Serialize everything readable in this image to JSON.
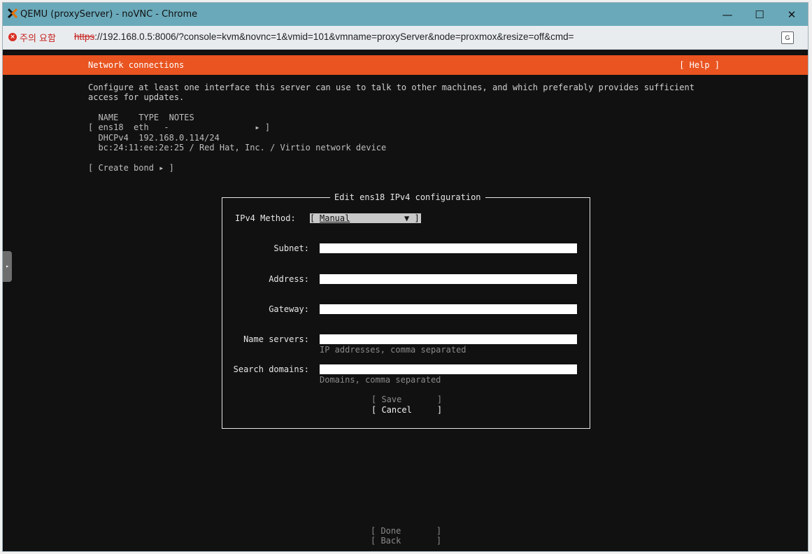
{
  "window": {
    "title": "QEMU (proxyServer) - noVNC - Chrome"
  },
  "controls": {
    "minimize": "—",
    "maximize": "☐",
    "close": "✕"
  },
  "addressbar": {
    "security_label": "주의 요함",
    "url_scheme": "https",
    "url_rest": "://192.168.0.5:8006/?console=kvm&novnc=1&vmid=101&vmname=proxyServer&node=proxmox&resize=off&cmd="
  },
  "installer": {
    "header_title": "Network connections",
    "help_label": "[ Help ]",
    "intro_line1": "Configure at least one interface this server can use to talk to other machines, and which preferably provides sufficient",
    "intro_line2": "access for updates.",
    "table_header": "  NAME    TYPE  NOTES",
    "iface_row": "[ ens18  eth   -                 ▸ ]",
    "iface_dhcp": "  DHCPv4  192.168.0.114/24",
    "iface_mac": "  bc:24:11:ee:2e:25 / Red Hat, Inc. / Virtio network device",
    "create_bond": "[ Create bond ▸ ]",
    "done_label": "[ Done       ]",
    "back_label": "[ Back       ]"
  },
  "dialog": {
    "title": "Edit ens18 IPv4 configuration",
    "method_label": "IPv4 Method:",
    "method_open": "[",
    "method_value": "Manual",
    "method_arrow": "▼ ]",
    "subnet_label": "Subnet:",
    "address_label": "Address:",
    "gateway_label": "Gateway:",
    "nameservers_label": "Name servers:",
    "nameservers_hint": "IP addresses, comma separated",
    "searchdomains_label": "Search domains:",
    "searchdomains_hint": "Domains, comma separated",
    "save_label": "[ Save       ]",
    "cancel_label": "[ Cancel     ]"
  },
  "colors": {
    "header": "#e95420",
    "titlebar": "#6aa9ba",
    "console_bg": "#111111"
  }
}
